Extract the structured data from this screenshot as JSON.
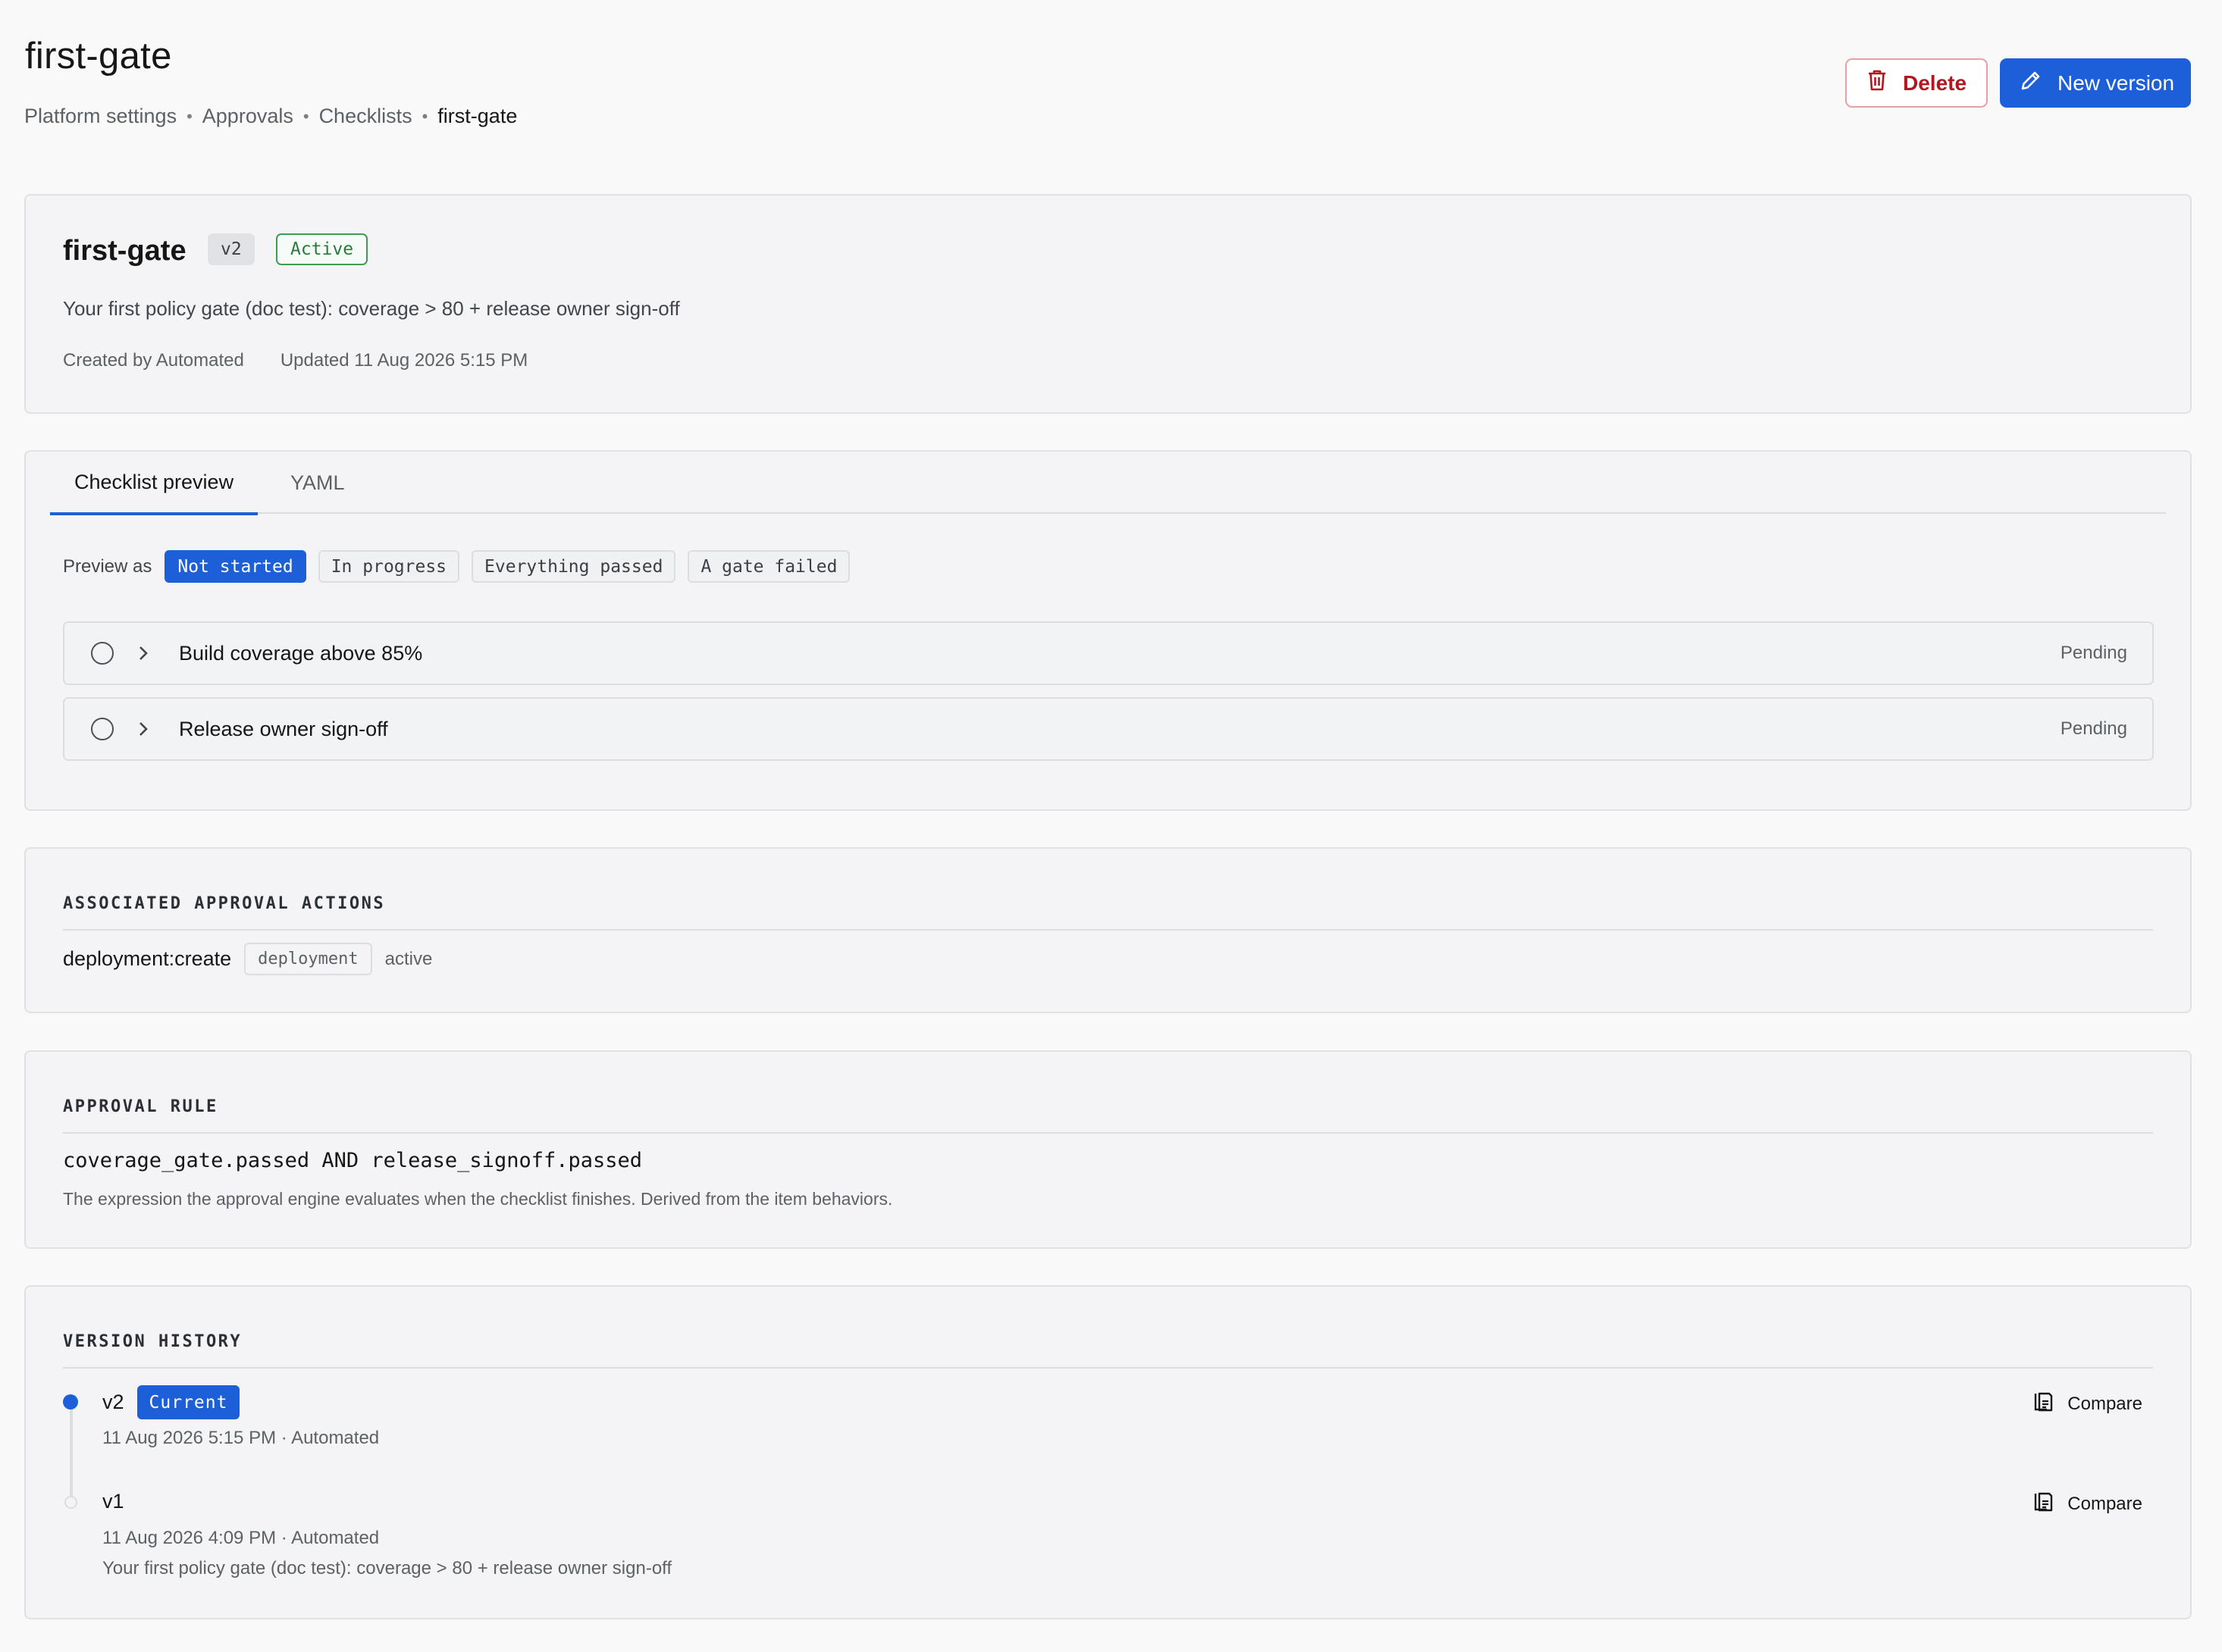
{
  "header": {
    "title": "first-gate",
    "breadcrumb": [
      "Platform settings",
      "Approvals",
      "Checklists",
      "first-gate"
    ],
    "delete_label": "Delete",
    "new_version_label": "New version"
  },
  "summary": {
    "name": "first-gate",
    "version": "v2",
    "status": "Active",
    "description": "Your first policy gate (doc test): coverage > 80 + release owner sign-off",
    "created_by": "Created by Automated",
    "updated": "Updated 11 Aug 2026 5:15 PM"
  },
  "tabs": [
    {
      "label": "Checklist preview",
      "active": true
    },
    {
      "label": "YAML",
      "active": false
    }
  ],
  "preview": {
    "label": "Preview as",
    "options": [
      "Not started",
      "In progress",
      "Everything passed",
      "A gate failed"
    ],
    "selected": "Not started"
  },
  "checklist": [
    {
      "label": "Build coverage above 85%",
      "status": "Pending"
    },
    {
      "label": "Release owner sign-off",
      "status": "Pending"
    }
  ],
  "actions": {
    "heading": "ASSOCIATED APPROVAL ACTIONS",
    "items": [
      {
        "name": "deployment:create",
        "type": "deployment",
        "state": "active"
      }
    ]
  },
  "rule": {
    "heading": "APPROVAL RULE",
    "expression": "coverage_gate.passed AND release_signoff.passed",
    "note": "The expression the approval engine evaluates when the checklist finishes. Derived from the item behaviors."
  },
  "history": {
    "heading": "VERSION HISTORY",
    "versions": [
      {
        "name": "v2",
        "badge": "Current",
        "meta": "11 Aug 2026 5:15 PM · Automated",
        "description": "",
        "compare_label": "Compare"
      },
      {
        "name": "v1",
        "badge": "",
        "meta": "11 Aug 2026 4:09 PM · Automated",
        "description": "Your first policy gate (doc test): coverage > 80 + release owner sign-off",
        "compare_label": "Compare"
      }
    ]
  },
  "colors": {
    "accent": "#1c5fd8",
    "danger": "#b3161f",
    "success": "#2a7a3d"
  },
  "icons": {
    "delete": "trash-icon",
    "new_version": "pencil-icon",
    "expand": "chevron-right-icon",
    "status": "empty-circle-icon",
    "compare": "documents-compare-icon"
  }
}
